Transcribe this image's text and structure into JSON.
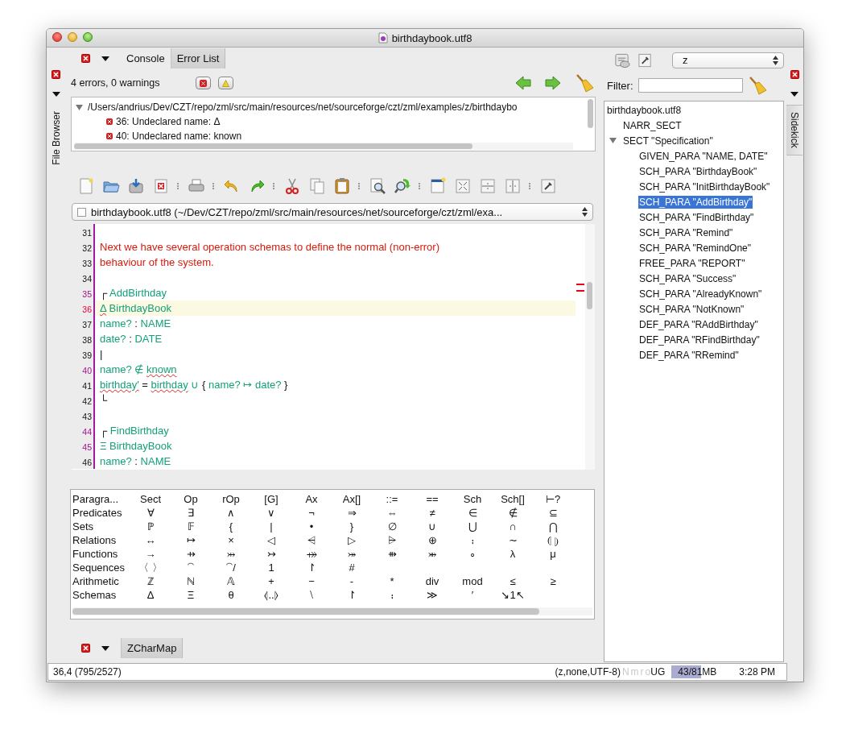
{
  "window": {
    "title": "birthdaybook.utf8"
  },
  "left_dock": {
    "tabs": [
      {
        "label": "File Browser",
        "selected": false
      }
    ]
  },
  "top_panel": {
    "tabs": [
      {
        "label": "Console",
        "selected": false
      },
      {
        "label": "Error List",
        "selected": true
      }
    ],
    "summary": "4 errors, 0 warnings",
    "error_tree": {
      "label": "/Users/andrius/Dev/CZT/repo/zml/src/main/resources/net/sourceforge/czt/zml/examples/z/birthdaybo",
      "expanded": true,
      "children": [
        {
          "label": "36: Undeclared name: Δ"
        },
        {
          "label": "40: Undeclared name: known"
        }
      ]
    }
  },
  "editor": {
    "buffer": "birthdaybook.utf8 (~/Dev/CZT/repo/zml/src/main/resources/net/sourceforge/czt/zml/exa...",
    "lines": [
      {
        "number": "31",
        "kind": "plain",
        "current": false
      },
      {
        "number": "32",
        "kind": "plain",
        "current": false,
        "segments": [
          {
            "text": "Next we have several operation schemas to define the normal (non-error)",
            "kind": "comment"
          }
        ]
      },
      {
        "number": "33",
        "kind": "plain",
        "current": false,
        "segments": [
          {
            "text": "behaviour of the system.",
            "kind": "comment"
          }
        ]
      },
      {
        "number": "34",
        "kind": "plain",
        "current": false
      },
      {
        "number": "35",
        "kind": "fold",
        "current": false,
        "segments": [
          {
            "text": "┌",
            "kind": "plain"
          },
          {
            "text": " AddBirthday",
            "kind": "z"
          }
        ]
      },
      {
        "number": "36",
        "kind": "error",
        "current": true,
        "segments": [
          {
            "text": "Δ",
            "kind": "error"
          },
          {
            "text": " BirthdayBook",
            "kind": "z"
          }
        ]
      },
      {
        "number": "37",
        "kind": "plain",
        "current": false,
        "segments": [
          {
            "text": "name?",
            "kind": "z"
          },
          {
            "text": " : ",
            "kind": "plain"
          },
          {
            "text": "NAME",
            "kind": "z"
          }
        ]
      },
      {
        "number": "38",
        "kind": "plain",
        "current": false,
        "segments": [
          {
            "text": "date?",
            "kind": "z"
          },
          {
            "text": " : ",
            "kind": "plain"
          },
          {
            "text": "DATE",
            "kind": "z"
          }
        ]
      },
      {
        "number": "39",
        "kind": "plain",
        "current": false,
        "segments": [
          {
            "text": "|",
            "kind": "plain"
          }
        ]
      },
      {
        "number": "40",
        "kind": "fold",
        "current": false,
        "segments": [
          {
            "text": "name? ∉ ",
            "kind": "z"
          },
          {
            "text": "known",
            "kind": "error"
          }
        ]
      },
      {
        "number": "41",
        "kind": "plain",
        "current": false,
        "segments": [
          {
            "text": "birthday′",
            "kind": "error"
          },
          {
            "text": " = ",
            "kind": "plain"
          },
          {
            "text": "birthday",
            "kind": "error"
          },
          {
            "text": " ∪ ",
            "kind": "z"
          },
          {
            "text": "{",
            "kind": "plain"
          },
          {
            "text": " name? ↦ date? ",
            "kind": "z"
          },
          {
            "text": "}",
            "kind": "plain"
          }
        ]
      },
      {
        "number": "42",
        "kind": "plain",
        "current": false,
        "segments": [
          {
            "text": "└",
            "kind": "plain"
          }
        ]
      },
      {
        "number": "43",
        "kind": "plain",
        "current": false
      },
      {
        "number": "44",
        "kind": "fold",
        "current": false,
        "segments": [
          {
            "text": "┌",
            "kind": "plain"
          },
          {
            "text": " FindBirthday",
            "kind": "z"
          }
        ]
      },
      {
        "number": "45",
        "kind": "fold",
        "current": false,
        "segments": [
          {
            "text": "Ξ BirthdayBook",
            "kind": "z"
          }
        ]
      },
      {
        "number": "46",
        "kind": "plain",
        "current": false,
        "segments": [
          {
            "text": "name?",
            "kind": "z"
          },
          {
            "text": " : ",
            "kind": "plain"
          },
          {
            "text": "NAME",
            "kind": "z"
          }
        ]
      }
    ]
  },
  "char_map": {
    "rows": [
      {
        "label": "Paragra...",
        "cells": [
          "Sect",
          "Op",
          "rOp",
          "[G]",
          "Ax",
          "Ax[]",
          "::=",
          "==",
          "Sch",
          "Sch[]",
          "⊢?"
        ]
      },
      {
        "label": "Predicates",
        "cells": [
          "∀",
          "∃",
          "∧",
          "∨",
          "¬",
          "⇒",
          "⇔",
          "≠",
          "∈",
          "∉",
          "⊆"
        ]
      },
      {
        "label": "Sets",
        "cells": [
          "ℙ",
          "𝔽",
          "{",
          "|",
          "•",
          "}",
          "∅",
          "∪",
          "⋃",
          "∩",
          "⋂"
        ]
      },
      {
        "label": "Relations",
        "cells": [
          "↔",
          "↦",
          "×",
          "◁",
          "⩤",
          "▷",
          "⩥",
          "⊕",
          "⨾",
          "∼",
          "⦇ ⦈"
        ]
      },
      {
        "label": "Functions",
        "cells": [
          "→",
          "⇸",
          "⤔",
          "↣",
          "⤀",
          "⤖",
          "⇻",
          "⤕",
          "∘",
          "λ",
          "μ"
        ]
      },
      {
        "label": "Sequences",
        "cells": [
          "〈 〉",
          "⁀",
          "⁀/",
          "1",
          "↾",
          "#"
        ]
      },
      {
        "label": "Arithmetic",
        "cells": [
          "ℤ",
          "ℕ",
          "𝔸",
          "+",
          "−",
          "-",
          "*",
          "div",
          "mod",
          "≤",
          "≥"
        ]
      },
      {
        "label": "Schemas",
        "cells": [
          "Δ",
          "Ξ",
          "θ",
          "⦉..⦊",
          "⧵",
          "↾",
          "⨾",
          "≫",
          "′",
          "↘1↖"
        ]
      }
    ]
  },
  "bottom_panel": {
    "tabs": [
      {
        "label": "ZCharMap",
        "selected": true
      }
    ]
  },
  "sidebar": {
    "mode": "z",
    "filter_label": "Filter:",
    "tree": {
      "label": "birthdaybook.utf8",
      "selected": false,
      "children": [
        {
          "label": "NARR_SECT",
          "selected": false
        },
        {
          "label": "SECT \"Specification\"",
          "selected": false,
          "expanded": true,
          "children": [
            {
              "label": "GIVEN_PARA \"NAME, DATE\"",
              "selected": false
            },
            {
              "label": "SCH_PARA \"BirthdayBook\"",
              "selected": false
            },
            {
              "label": "SCH_PARA \"InitBirthdayBook\"",
              "selected": false
            },
            {
              "label": "SCH_PARA \"AddBirthday\"",
              "selected": true
            },
            {
              "label": "SCH_PARA \"FindBirthday\"",
              "selected": false
            },
            {
              "label": "SCH_PARA \"Remind\"",
              "selected": false
            },
            {
              "label": "SCH_PARA \"RemindOne\"",
              "selected": false
            },
            {
              "label": "FREE_PARA \"REPORT\"",
              "selected": false
            },
            {
              "label": "SCH_PARA \"Success\"",
              "selected": false
            },
            {
              "label": "SCH_PARA \"AlreadyKnown\"",
              "selected": false
            },
            {
              "label": "SCH_PARA \"NotKnown\"",
              "selected": false
            },
            {
              "label": "DEF_PARA \"RAddBirthday\"",
              "selected": false
            },
            {
              "label": "DEF_PARA \"RFindBirthday\"",
              "selected": false
            },
            {
              "label": "DEF_PARA \"RRemind\"",
              "selected": false
            }
          ]
        }
      ]
    }
  },
  "right_dock": {
    "tabs": [
      {
        "label": "Sidekick",
        "selected": true
      }
    ]
  },
  "status_bar": {
    "position": "36,4 (795/2527)",
    "encoding": "(z,none,UTF-8)",
    "flags": [
      {
        "label": "N",
        "on": false
      },
      {
        "label": "m",
        "on": false
      },
      {
        "label": "r",
        "on": false
      },
      {
        "label": "o",
        "on": false
      },
      {
        "label": "U",
        "on": true
      },
      {
        "label": "G",
        "on": true
      }
    ],
    "memory": {
      "text": "43/81MB",
      "level": 0.56
    },
    "time": "3:28 PM"
  }
}
